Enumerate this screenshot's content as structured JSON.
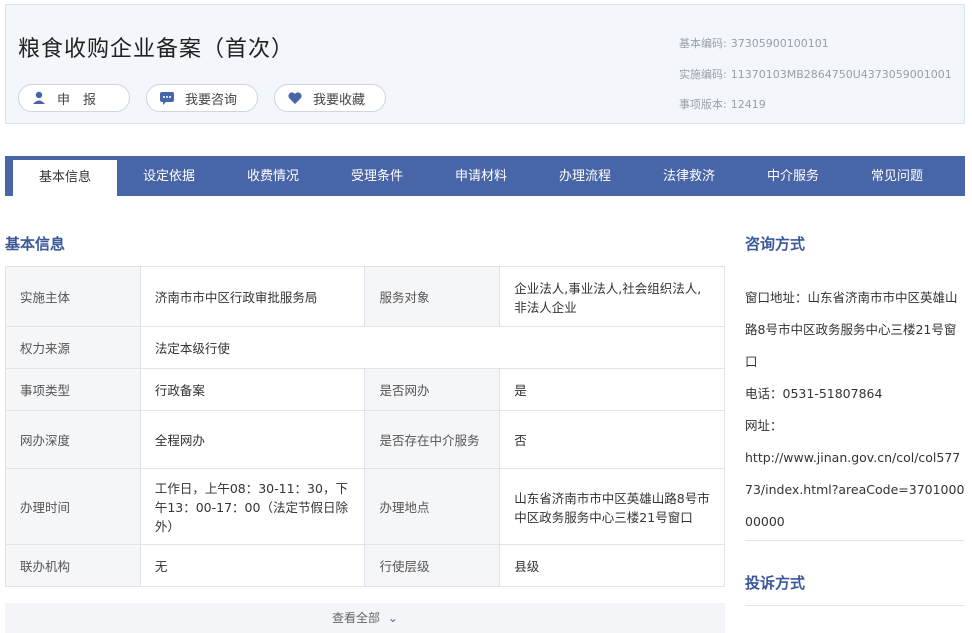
{
  "header": {
    "title": "粮食收购企业备案（首次）",
    "buttons": {
      "declare": "申　报",
      "consult": "我要咨询",
      "favorite": "我要收藏"
    },
    "meta": [
      {
        "label": "基本编码:",
        "value": "37305900100101"
      },
      {
        "label": "实施编码:",
        "value": "11370103MB2864750U4373059001001"
      },
      {
        "label": "事项版本:",
        "value": "12419"
      }
    ]
  },
  "tabs": [
    "基本信息",
    "设定依据",
    "收费情况",
    "受理条件",
    "申请材料",
    "办理流程",
    "法律救济",
    "中介服务",
    "常见问题"
  ],
  "basic_info": {
    "title": "基本信息",
    "rows": [
      {
        "k1": "实施主体",
        "v1": "济南市市中区行政审批服务局",
        "k2": "服务对象",
        "v2": "企业法人,事业法人,社会组织法人,非法人企业"
      },
      {
        "k1": "权力来源",
        "v1": "法定本级行使"
      },
      {
        "k1": "事项类型",
        "v1": "行政备案",
        "k2": "是否网办",
        "v2": "是"
      },
      {
        "k1": "网办深度",
        "v1": "全程网办",
        "k2": "是否存在中介服务",
        "v2": "否"
      },
      {
        "k1": "办理时间",
        "v1": "工作日，上午08：30-11：30，下午13：00-17：00（法定节假日除外）",
        "k2": "办理地点",
        "v2": "山东省济南市市中区英雄山路8号市中区政务服务中心三楼21号窗口"
      },
      {
        "k1": "联办机构",
        "v1": "无",
        "k2": "行使层级",
        "v2": "县级"
      }
    ],
    "view_all": "查看全部"
  },
  "consult": {
    "title": "咨询方式",
    "address": "窗口地址：山东省济南市市中区英雄山路8号市中区政务服务中心三楼21号窗口",
    "phone": "电话：0531-51807864",
    "url_label": "网址：",
    "url": "http://www.jinan.gov.cn/col/col57773/index.html?areaCode=370100000000"
  },
  "complaint": {
    "title": "投诉方式"
  },
  "colors": {
    "tab_bar": "#4865a8",
    "accent_title": "#3b5998",
    "header_bg": "#f3f6fb"
  }
}
